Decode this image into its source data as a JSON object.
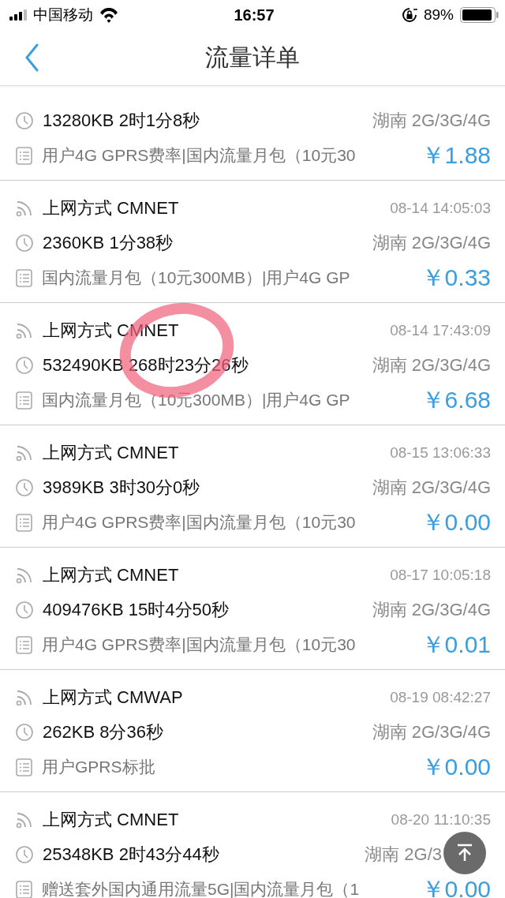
{
  "status_bar": {
    "carrier": "中国移动",
    "time": "16:57",
    "battery": "89%"
  },
  "nav": {
    "title": "流量详单"
  },
  "records": [
    {
      "usage": "13280KB 2时1分8秒",
      "region": "湖南 2G/3G/4G",
      "package": "用户4G GPRS费率|国内流量月包（10元30",
      "price": "￥1.88"
    },
    {
      "mode": "上网方式 CMNET",
      "time": "08-14 14:05:03",
      "usage": "2360KB 1分38秒",
      "region": "湖南 2G/3G/4G",
      "package": "国内流量月包（10元300MB）|用户4G GP",
      "price": "￥0.33"
    },
    {
      "mode": "上网方式 CMNET",
      "time": "08-14 17:43:09",
      "usage": "532490KB 268时23分26秒",
      "region": "湖南 2G/3G/4G",
      "package": "国内流量月包（10元300MB）|用户4G GP",
      "price": "￥6.68"
    },
    {
      "mode": "上网方式 CMNET",
      "time": "08-15 13:06:33",
      "usage": "3989KB 3时30分0秒",
      "region": "湖南 2G/3G/4G",
      "package": "用户4G GPRS费率|国内流量月包（10元30",
      "price": "￥0.00"
    },
    {
      "mode": "上网方式 CMNET",
      "time": "08-17 10:05:18",
      "usage": "409476KB 15时4分50秒",
      "region": "湖南 2G/3G/4G",
      "package": "用户4G GPRS费率|国内流量月包（10元30",
      "price": "￥0.01"
    },
    {
      "mode": "上网方式 CMWAP",
      "time": "08-19 08:42:27",
      "usage": "262KB 8分36秒",
      "region": "湖南 2G/3G/4G",
      "package": "用户GPRS标批",
      "price": "￥0.00"
    },
    {
      "mode": "上网方式 CMNET",
      "time": "08-20 11:10:35",
      "usage": "25348KB 2时43分44秒",
      "region": "湖南 2G/3",
      "package": "赠送套外国内通用流量5G|国内流量月包（1",
      "price": "￥0.00"
    }
  ]
}
